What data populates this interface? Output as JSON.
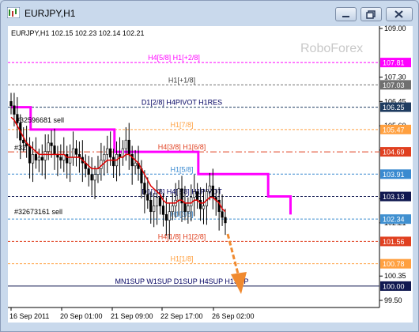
{
  "window": {
    "title": "EURJPY,H1",
    "colors": {
      "frame": "#c9d9ec",
      "chart_bg": "#ffffff",
      "candles": "#000000",
      "ma": "#e00000",
      "pivot": "#ff00ff",
      "arrow": "#f08a30",
      "watermark": "#c8c8c8"
    }
  },
  "chart": {
    "info": "EURJPY,H1  102.15 102.23 102.14 102.21",
    "watermark": "RoboForex",
    "price_axis": [
      "109.00",
      "107.30",
      "106.45",
      "105.60",
      "104.75",
      "103.05",
      "102.21",
      "100.35",
      "99.50"
    ],
    "price_tags": [
      {
        "text": "107.81",
        "bg": "#ff00ff"
      },
      {
        "text": "107.03",
        "bg": "#707070"
      },
      {
        "text": "106.25",
        "bg": "#1f3c60"
      },
      {
        "text": "105.47",
        "bg": "#ffa040"
      },
      {
        "text": "104.69",
        "bg": "#e04020"
      },
      {
        "text": "103.91",
        "bg": "#3a8ad0"
      },
      {
        "text": "103.13",
        "bg": "#101850"
      },
      {
        "text": "102.34",
        "bg": "#4090d0"
      },
      {
        "text": "101.56",
        "bg": "#e04020"
      },
      {
        "text": "100.78",
        "bg": "#ffa040"
      },
      {
        "text": "100.00",
        "bg": "#101850"
      }
    ],
    "line_labels": [
      {
        "text": "H4[5/8] H1[+2/8]",
        "color": "#ff00ff"
      },
      {
        "text": "H1[+1/8]",
        "color": "#404040"
      },
      {
        "text": "D1[2/8] H4PIVOT H1RES",
        "color": "#000060"
      },
      {
        "text": "H1[7/8]",
        "color": "#ffa040"
      },
      {
        "text": "H4[3/8] H1[6/8]",
        "color": "#e04020"
      },
      {
        "text": "H1[5/8]",
        "color": "#3a8ad0"
      },
      {
        "text": "D1[1/8] H4[2/8] H1PIVOT",
        "color": "#000060"
      },
      {
        "text": "H1[3/8]",
        "color": "#3a8ad0"
      },
      {
        "text": "H4[1/8] H1[2/8]",
        "color": "#e04020"
      },
      {
        "text": "H1[1/8]",
        "color": "#ffa040"
      },
      {
        "text": "MN1SUP W1SUP D1SUP H4SUP H1SUP",
        "color": "#000060"
      }
    ],
    "order_labels": [
      "#32596681 sell",
      "#32",
      "#32673161 sell"
    ],
    "time_axis": [
      "16 Sep 2011",
      "20 Sep 01:00",
      "21 Sep 09:00",
      "22 Sep 17:00",
      "26 Sep 02:00"
    ]
  },
  "chart_data": {
    "type": "candlestick",
    "ylim": [
      99.5,
      109.0
    ],
    "close": [
      106.3,
      106.0,
      105.7,
      105.1,
      105.0,
      104.9,
      104.3,
      104.6,
      104.4,
      104.5,
      104.4,
      104.7,
      105.0,
      104.9,
      104.6,
      104.5,
      104.4,
      104.6,
      104.3,
      104.5,
      104.8,
      104.6,
      104.5,
      104.3,
      104.1,
      103.9,
      103.7,
      103.9,
      104.1,
      104.4,
      104.6,
      104.8,
      104.5,
      104.2,
      104.6,
      104.5,
      104.8,
      105.1,
      104.6,
      104.2,
      104.3,
      104.1,
      103.6,
      103.2,
      103.0,
      102.6,
      102.8,
      103.1,
      102.8,
      102.5,
      102.3,
      102.6,
      102.8,
      103.0,
      103.4,
      102.9,
      102.6,
      102.8,
      103.1,
      103.3,
      103.0,
      102.7,
      102.8,
      103.3,
      103.5,
      103.1,
      103.0,
      102.6,
      102.4,
      102.21
    ],
    "ma": [
      105.9,
      105.8,
      105.6,
      105.4,
      105.2,
      105.0,
      104.9,
      104.8,
      104.7,
      104.6,
      104.6,
      104.6,
      104.6,
      104.6,
      104.6,
      104.6,
      104.6,
      104.6,
      104.5,
      104.5,
      104.5,
      104.5,
      104.5,
      104.4,
      104.3,
      104.2,
      104.1,
      104.1,
      104.1,
      104.2,
      104.3,
      104.4,
      104.4,
      104.4,
      104.4,
      104.5,
      104.5,
      104.6,
      104.6,
      104.5,
      104.4,
      104.3,
      104.1,
      103.9,
      103.7,
      103.5,
      103.4,
      103.3,
      103.2,
      103.0,
      102.9,
      102.9,
      102.9,
      102.9,
      103.0,
      103.0,
      102.9,
      102.9,
      102.9,
      103.0,
      103.0,
      102.9,
      102.9,
      103.0,
      103.1,
      103.1,
      103.0,
      102.9,
      102.7,
      102.6
    ],
    "pivot_steps": [
      [
        106.25,
        7
      ],
      [
        105.47,
        30
      ],
      [
        104.69,
        30
      ],
      [
        103.91,
        25
      ],
      [
        103.13,
        8
      ]
    ]
  }
}
